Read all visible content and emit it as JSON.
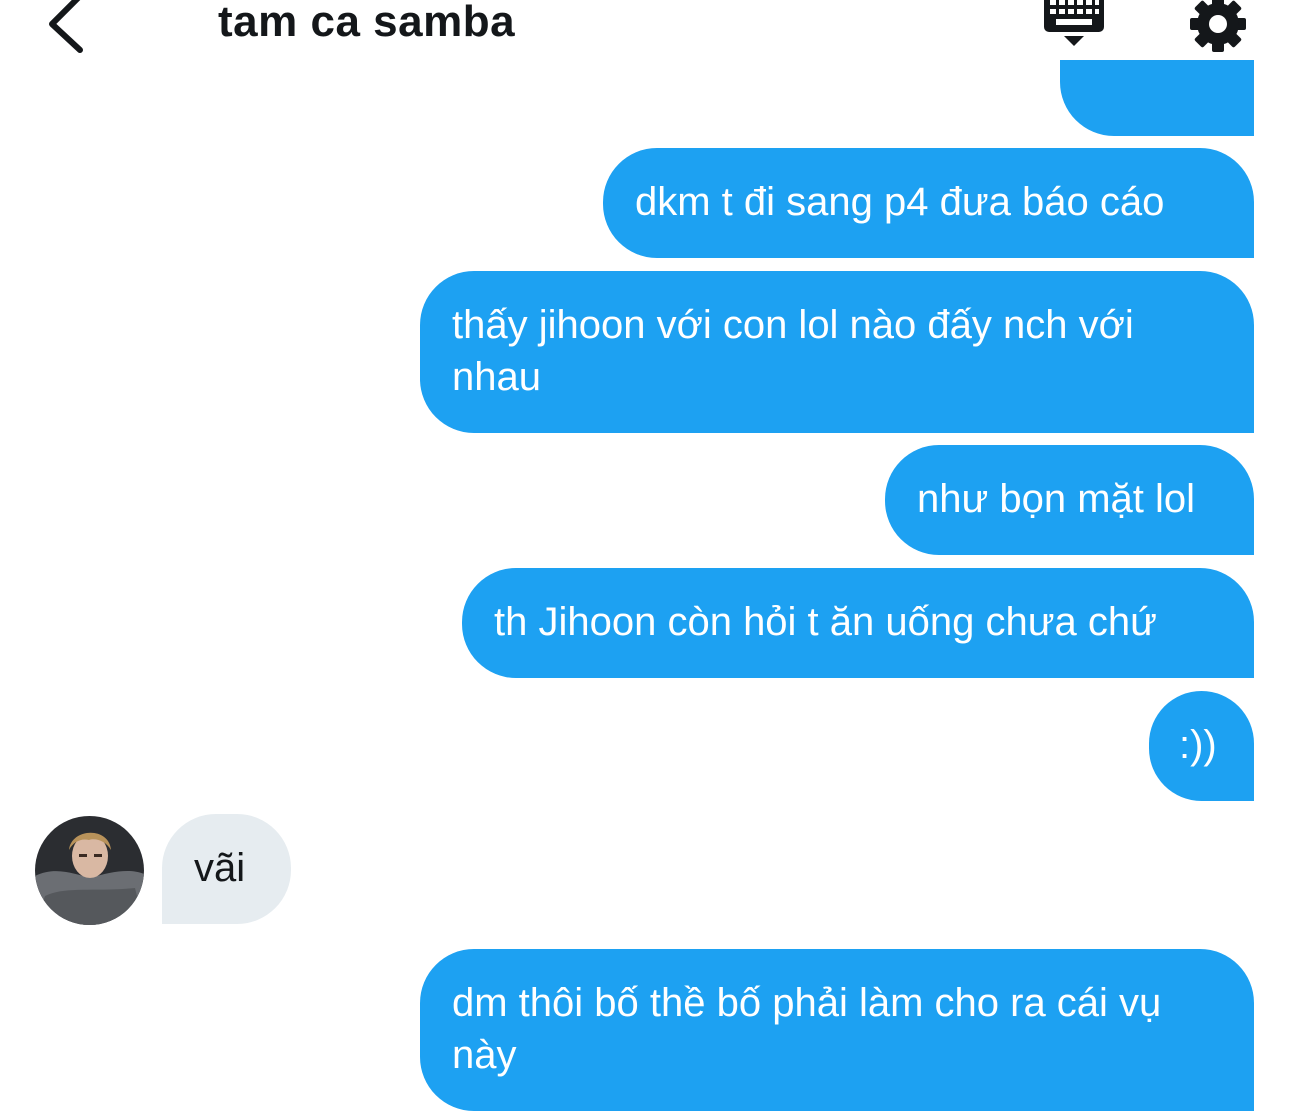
{
  "header": {
    "title": "tam ca samba",
    "back_icon": "chevron-left-icon",
    "keyboard_icon": "keyboard-icon",
    "settings_icon": "gear-icon"
  },
  "colors": {
    "outgoing_bubble": "#1da1f2",
    "incoming_bubble": "#e6ecf0",
    "text_dark": "#14171a"
  },
  "messages": [
    {
      "direction": "outgoing",
      "text": ""
    },
    {
      "direction": "outgoing",
      "text": "dkm t đi sang p4 đưa báo cáo"
    },
    {
      "direction": "outgoing",
      "text": "thấy jihoon với con lol nào đấy nch với nhau"
    },
    {
      "direction": "outgoing",
      "text": "như bọn mặt lol"
    },
    {
      "direction": "outgoing",
      "text": "th Jihoon còn hỏi t ăn uống chưa chứ"
    },
    {
      "direction": "outgoing",
      "text": ":))"
    },
    {
      "direction": "incoming",
      "text": "vãi"
    },
    {
      "direction": "outgoing",
      "text": "dm thôi bố thề bố phải làm cho ra cái vụ này"
    }
  ]
}
